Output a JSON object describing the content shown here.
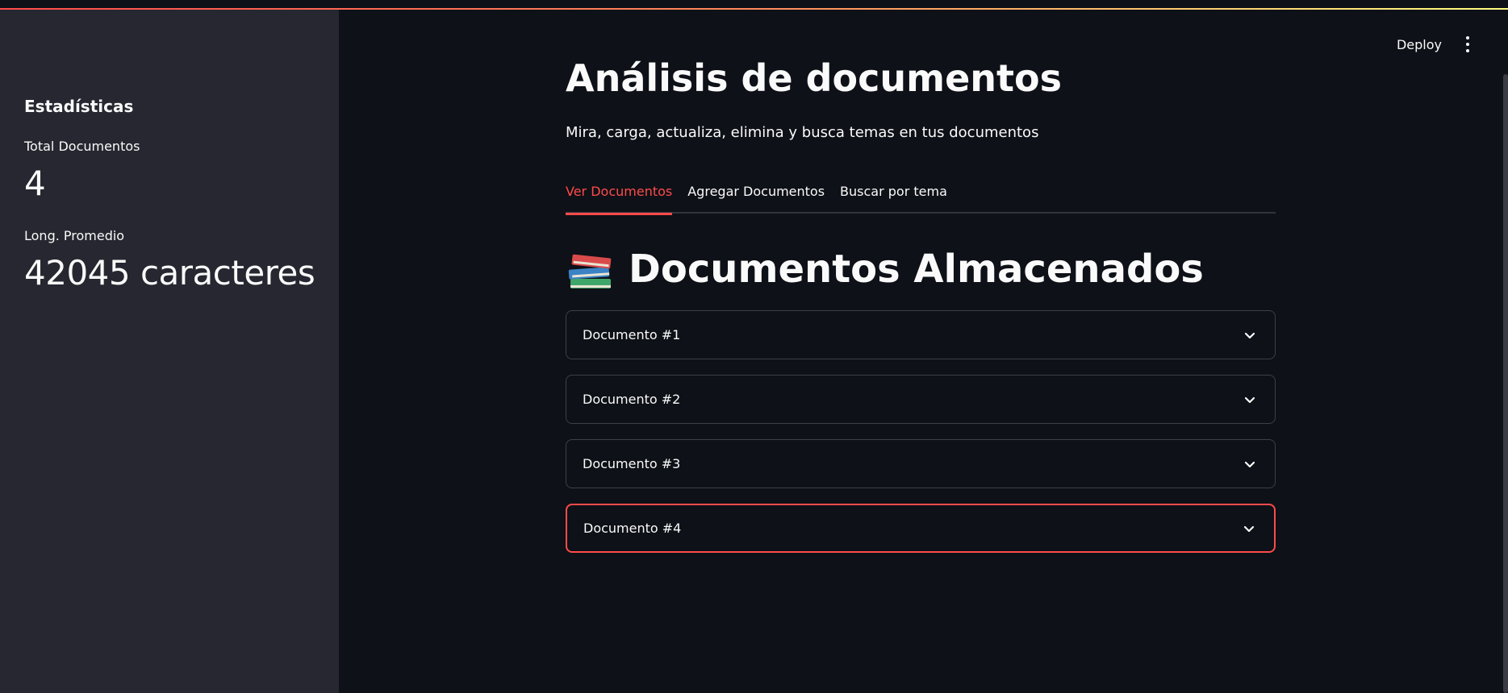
{
  "sidebar": {
    "title": "Estadísticas",
    "metrics": [
      {
        "label": "Total Documentos",
        "value": "4"
      },
      {
        "label": "Long. Promedio",
        "value": "42045 caracteres"
      }
    ]
  },
  "header": {
    "deploy_label": "Deploy",
    "menu_icon": "vertical-ellipsis-icon"
  },
  "main": {
    "title": "Análisis de documentos",
    "subtitle": "Mira, carga, actualiza, elimina y busca temas en tus documentos",
    "tabs": [
      {
        "label": "Ver Documentos",
        "active": true
      },
      {
        "label": "Agregar Documentos",
        "active": false
      },
      {
        "label": "Buscar por tema",
        "active": false
      }
    ],
    "section_icon": "books-icon",
    "section_title": "Documentos Almacenados",
    "documents": [
      {
        "label": "Documento #1"
      },
      {
        "label": "Documento #2"
      },
      {
        "label": "Documento #3"
      },
      {
        "label": "Documento #4",
        "focused": true
      }
    ]
  },
  "colors": {
    "accent": "#ff4b4b",
    "background": "#0e1117",
    "sidebar": "#262730"
  }
}
